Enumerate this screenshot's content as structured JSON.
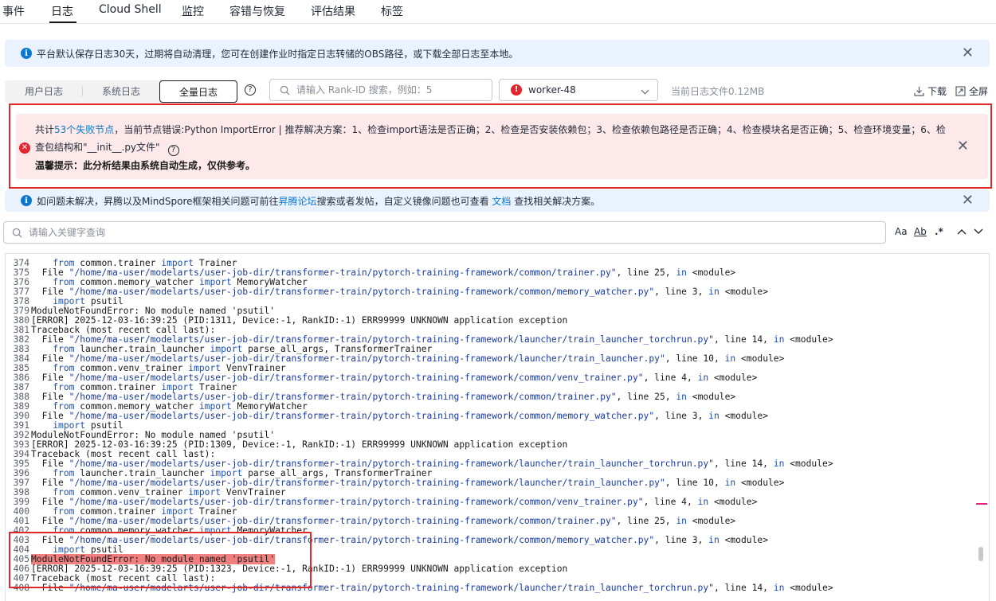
{
  "tabs": [
    {
      "label": "事件"
    },
    {
      "label": "日志"
    },
    {
      "label": "Cloud Shell"
    },
    {
      "label": "监控"
    },
    {
      "label": "容错与恢复"
    },
    {
      "label": "评估结果"
    },
    {
      "label": "标签"
    }
  ],
  "notice1": {
    "text": "平台默认保存日志30天，过期将自动清理，您可在创建作业时指定日志转储的OBS路径，或下载全部日志至本地。"
  },
  "toolbar": {
    "log_types": [
      "用户日志",
      "系统日志",
      "全量日志"
    ],
    "rank_placeholder": "请输入 Rank-ID 搜索，例如：5",
    "worker": "worker-48",
    "file_size": "当前日志文件0.12MB",
    "download": "下载",
    "fullscreen": "全屏"
  },
  "alert": {
    "prefix": "共计",
    "failed_nodes_link": "53个失败节点",
    "message": "，当前节点错误:Python ImportError | 推荐解决方案：1、检查import语法是否正确；2、检查是否安装依赖包；3、检查依赖包路径是否正确；4、检查模块名是否正确；5、检查环境变量；6、检查包结构和\"__init__.py文件\"",
    "tip": "温馨提示：此分析结果由系统自动生成，仅供参考。"
  },
  "notice2": {
    "part1": "如问题未解决，昇腾以及MindSpore框架相关问题可前往",
    "forum_link": "昇腾论坛",
    "part2": "搜索或者发帖，自定义镜像问题也可查看",
    "doc_link": "文档",
    "part3": "查找相关解决方案。"
  },
  "keyword_search": {
    "placeholder": "请输入关键字查询"
  },
  "search_options": {
    "case": "Aa",
    "word": "Ab",
    "regex": ".*"
  },
  "log_lines": [
    {
      "n": "374",
      "t": "    from common.trainer import Trainer"
    },
    {
      "n": "375",
      "t": "  File \"/home/ma-user/modelarts/user-job-dir/transformer-train/pytorch-training-framework/common/trainer.py\", line 25, in <module>"
    },
    {
      "n": "376",
      "t": "    from common.memory_watcher import MemoryWatcher"
    },
    {
      "n": "377",
      "t": "  File \"/home/ma-user/modelarts/user-job-dir/transformer-train/pytorch-training-framework/common/memory_watcher.py\", line 3, in <module>"
    },
    {
      "n": "378",
      "t": "    import psutil"
    },
    {
      "n": "379",
      "t": "ModuleNotFoundError: No module named 'psutil'"
    },
    {
      "n": "380",
      "t": "[ERROR] 2025-12-03-16:39:25 (PID:1311, Device:-1, RankID:-1) ERR99999 UNKNOWN application exception"
    },
    {
      "n": "381",
      "t": "Traceback (most recent call last):"
    },
    {
      "n": "382",
      "t": "  File \"/home/ma-user/modelarts/user-job-dir/transformer-train/pytorch-training-framework/launcher/train_launcher_torchrun.py\", line 14, in <module>"
    },
    {
      "n": "383",
      "t": "    from launcher.train_launcher import parse_all_args, TransformerTrainer"
    },
    {
      "n": "384",
      "t": "  File \"/home/ma-user/modelarts/user-job-dir/transformer-train/pytorch-training-framework/launcher/train_launcher.py\", line 10, in <module>"
    },
    {
      "n": "385",
      "t": "    from common.venv_trainer import VenvTrainer"
    },
    {
      "n": "386",
      "t": "  File \"/home/ma-user/modelarts/user-job-dir/transformer-train/pytorch-training-framework/common/venv_trainer.py\", line 4, in <module>"
    },
    {
      "n": "387",
      "t": "    from common.trainer import Trainer"
    },
    {
      "n": "388",
      "t": "  File \"/home/ma-user/modelarts/user-job-dir/transformer-train/pytorch-training-framework/common/trainer.py\", line 25, in <module>"
    },
    {
      "n": "389",
      "t": "    from common.memory_watcher import MemoryWatcher"
    },
    {
      "n": "390",
      "t": "  File \"/home/ma-user/modelarts/user-job-dir/transformer-train/pytorch-training-framework/common/memory_watcher.py\", line 3, in <module>"
    },
    {
      "n": "391",
      "t": "    import psutil"
    },
    {
      "n": "392",
      "t": "ModuleNotFoundError: No module named 'psutil'"
    },
    {
      "n": "393",
      "t": "[ERROR] 2025-12-03-16:39:25 (PID:1309, Device:-1, RankID:-1) ERR99999 UNKNOWN application exception"
    },
    {
      "n": "394",
      "t": "Traceback (most recent call last):"
    },
    {
      "n": "395",
      "t": "  File \"/home/ma-user/modelarts/user-job-dir/transformer-train/pytorch-training-framework/launcher/train_launcher_torchrun.py\", line 14, in <module>"
    },
    {
      "n": "396",
      "t": "    from launcher.train_launcher import parse_all_args, TransformerTrainer"
    },
    {
      "n": "397",
      "t": "  File \"/home/ma-user/modelarts/user-job-dir/transformer-train/pytorch-training-framework/launcher/train_launcher.py\", line 10, in <module>"
    },
    {
      "n": "398",
      "t": "    from common.venv_trainer import VenvTrainer"
    },
    {
      "n": "399",
      "t": "  File \"/home/ma-user/modelarts/user-job-dir/transformer-train/pytorch-training-framework/common/venv_trainer.py\", line 4, in <module>"
    },
    {
      "n": "400",
      "t": "    from common.trainer import Trainer"
    },
    {
      "n": "401",
      "t": "  File \"/home/ma-user/modelarts/user-job-dir/transformer-train/pytorch-training-framework/common/trainer.py\", line 25, in <module>"
    },
    {
      "n": "402",
      "t": "    from common.memory_watcher import MemoryWatcher"
    },
    {
      "n": "403",
      "t": "  File \"/home/ma-user/modelarts/user-job-dir/transformer-train/pytorch-training-framework/common/memory_watcher.py\", line 3, in <module>"
    },
    {
      "n": "404",
      "t": "    import psutil"
    },
    {
      "n": "405",
      "t": "ModuleNotFoundError: No module named 'psutil'",
      "highlight": true
    },
    {
      "n": "406",
      "t": "[ERROR] 2025-12-03-16:39:25 (PID:1323, Device:-1, RankID:-1) ERR99999 UNKNOWN application exception"
    },
    {
      "n": "407",
      "t": "Traceback (most recent call last):"
    },
    {
      "n": "408",
      "t": "  File \"/home/ma-user/modelarts/user-job-dir/transformer-train/pytorch-training-framework/launcher/train_launcher_torchrun.py\", line 14, in <module>"
    }
  ],
  "colors": {
    "accent": "#0b79d0",
    "error": "#e6242e",
    "alert_bg": "#fde9e9",
    "info_bg": "#eaf2ff",
    "highlight": "#f08080"
  }
}
